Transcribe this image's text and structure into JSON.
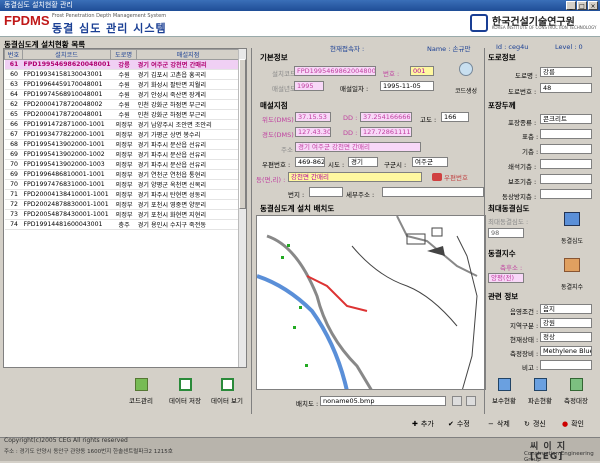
{
  "window": {
    "title": "동결심도 설치현황 관리"
  },
  "header": {
    "logo": "FPDMS",
    "logo_sub": "Frost Penetration Depth Management System",
    "logo_kor": "동결 심도 관리 시스템",
    "org_name": "한국건설기술연구원",
    "org_eng": "KOREA INSTITUTE OF CONSTRUCTION TECHNOLOGY"
  },
  "status": {
    "current_user_label": "현재접속자 :",
    "name_label": "Name : 손규만",
    "id_label": "Id : ceg4u",
    "level_label": "Level : 0"
  },
  "left": {
    "title": "동결심도계 설치현황 목록",
    "columns": [
      "번호",
      "설치코드",
      "도로명",
      "매설지점"
    ],
    "rows": [
      [
        "61",
        "FPD19954698620048001",
        "강릉",
        "경기 여주군 강천면 간매리"
      ],
      [
        "60",
        "FPD19934158130043001",
        "수원",
        "경기 김포시 고촌읍 홍곡리"
      ],
      [
        "63",
        "FPD19964459170048001",
        "수원",
        "경기 화성시 팔탄면 지월리"
      ],
      [
        "64",
        "FPD19974568910048001",
        "수원",
        "경기 안성시 죽산면 장계리"
      ],
      [
        "62",
        "FPD20004178720048002",
        "수원",
        "인천 강화군 하점면 부근리"
      ],
      [
        "65",
        "FPD20004178720048001",
        "수원",
        "인천 강화군 하점면 부근리"
      ],
      [
        "66",
        "FPD1991472871000-1001",
        "의정부",
        "경기 남양주시 조안면 조안리"
      ],
      [
        "67",
        "FPD1993477822000-1001",
        "의정부",
        "경기 가평군 상면 봉수리"
      ],
      [
        "68",
        "FPD1995413902000-1001",
        "의정부",
        "경기 파주시 문산읍 선유리"
      ],
      [
        "69",
        "FPD1995413902000-1002",
        "의정부",
        "경기 파주시 문산읍 선유리"
      ],
      [
        "70",
        "FPD1995413902000-1003",
        "의정부",
        "경기 파주시 문산읍 선유리"
      ],
      [
        "69",
        "FPD1996486810001-1001",
        "의정부",
        "경기 연천군 연천읍 통현리"
      ],
      [
        "70",
        "FPD1997476831000-1001",
        "의정부",
        "경기 양평군 옥천면 신복리"
      ],
      [
        "71",
        "FPD20004138410001-1001",
        "의정부",
        "경기 파주시 탄현면 성동리"
      ],
      [
        "72",
        "FPD20024878830001-1001",
        "의정부",
        "경기 포천시 영중면 양문리"
      ],
      [
        "73",
        "FPD20054878430001-1001",
        "의정부",
        "경기 포천시 화현면 지현리"
      ],
      [
        "74",
        "FPD19914481600043001",
        "충주",
        "경기 용인시 수지구 죽전동"
      ]
    ]
  },
  "left_buttons": [
    {
      "label": "코드관리",
      "icon": "code-manage-icon"
    },
    {
      "label": "데이터 저장",
      "icon": "excel-save-icon"
    },
    {
      "label": "데이터 보기",
      "icon": "excel-view-icon"
    }
  ],
  "basic": {
    "title": "기본정보",
    "code_label": "설치코드 :",
    "code_value": "FPD19954698620048001",
    "no_label": "번호 :",
    "no_value": "001",
    "year_label": "매설년도 :",
    "year_value": "1995",
    "date_label": "매설일자 :",
    "date_value": "1995-11-05",
    "code_gen_label": "코드생성"
  },
  "location": {
    "title": "매설지점",
    "lat_label": "위도(DMS) :",
    "lat_value": "37.15.53",
    "lat_dd_label": "DD :",
    "lat_dd_value": "37.2541666666",
    "alt_label": "고도 :",
    "alt_value": "166",
    "lon_label": "경도(DMS) :",
    "lon_value": "127.43.30",
    "lon_dd_label": "DD :",
    "lon_dd_value": "127.72861111",
    "addr_label": "주소 :",
    "addr_value": "경기 여주군 강천면 간매리",
    "zip_label": "우편번호 :",
    "zip_value": "469-862",
    "sido_label": "시도 :",
    "sido_value": "경기",
    "gugun_label": "구군시 :",
    "gugun_value": "여주군",
    "dong_label": "동(면,리) :",
    "dong_value": "강천면 간매리",
    "zip_btn": "우편번호",
    "bunji_label": "번지 :",
    "bunji_value": "",
    "detail_label": "세부주소 :",
    "detail_value": ""
  },
  "map": {
    "title": "동결심도계 설치 배치도",
    "file_label": "배치도 :",
    "file_value": "noname05.bmp"
  },
  "road": {
    "title": "도로정보",
    "road_label": "도로명 :",
    "road_value": "강릉",
    "roadno_label": "도로번호 :",
    "roadno_value": "48"
  },
  "pavement": {
    "title": "포장두께",
    "type_label": "포장종류 :",
    "type_value": "콘크리트",
    "surface_label": "표층 :",
    "base_label": "기층 :",
    "subbase_label": "쇄석기층 :",
    "filter_label": "보조기층 :",
    "frost_label": "동상방지층 :"
  },
  "maxdepth": {
    "title": "최대동결심도",
    "label": "최대동결심도 :",
    "value": "98",
    "btn": "동결심도"
  },
  "frostindex": {
    "title": "동결지수",
    "label": "측후소 :",
    "value": "양평(전)",
    "btn": "동결지수"
  },
  "related": {
    "title": "관련 정보",
    "drain_label": "음영조건 :",
    "drain_value": "음지",
    "soil_label": "지역구분 :",
    "soil_value": "강원",
    "state_label": "현재상태 :",
    "state_value": "정상",
    "sensor_label": "측정장비 :",
    "sensor_value": "Methylene Blue",
    "note_label": "비고 :",
    "note_value": ""
  },
  "right_buttons": [
    "보수현황",
    "파손현황",
    "측정대장"
  ],
  "actions": [
    "추가",
    "수정",
    "삭제",
    "갱신",
    "확인"
  ],
  "footer": {
    "copyright": "Copyright(c)2005 CEG All rights reserved",
    "address": "주소 : 경기도 안양시 동안구 관양동 1600번지 한솔센트럴파크2 1215호",
    "ceg": "씨 이 지 [CEG]",
    "ceg_eng": "Construction Engineering Group"
  }
}
